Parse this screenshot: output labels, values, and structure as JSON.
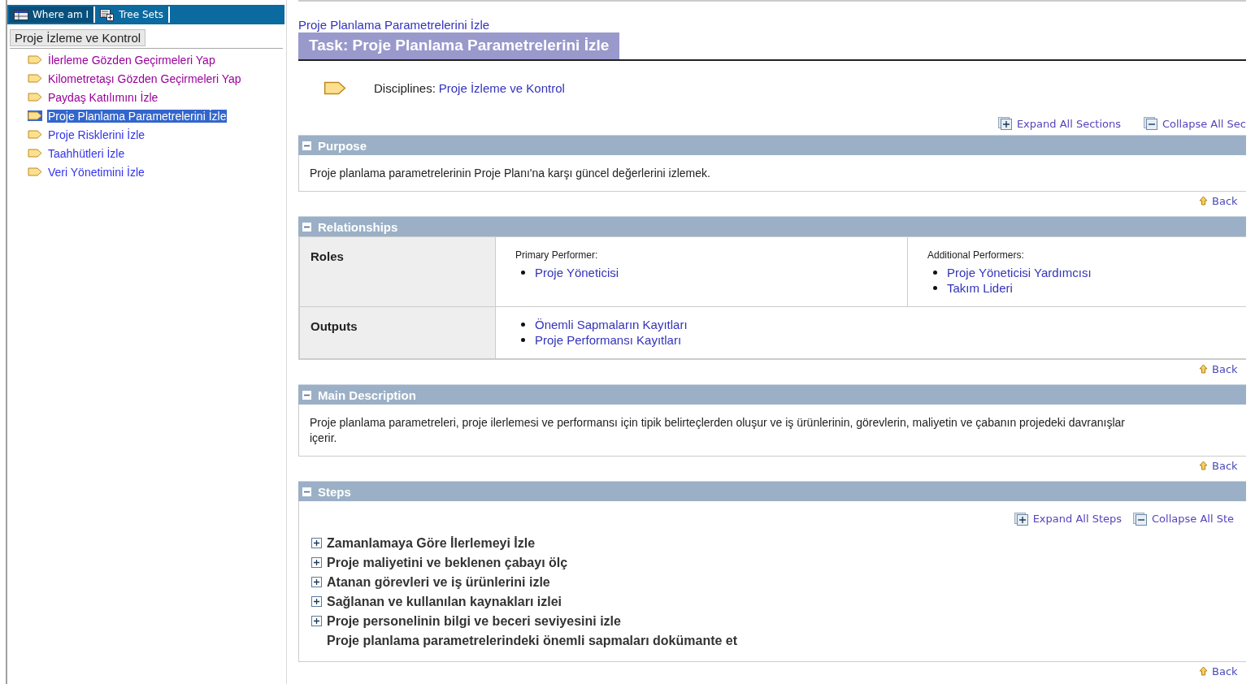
{
  "sidebar": {
    "tabs": [
      {
        "label": "Where am I",
        "selected": true
      },
      {
        "label": "Tree Sets",
        "selected": false
      }
    ],
    "root": "Proje İzleme ve Kontrol",
    "items": [
      {
        "label": "İlerleme Gözden Geçirmeleri Yap",
        "visited": true,
        "selected": false
      },
      {
        "label": "Kilometretaşı Gözden Geçirmeleri Yap",
        "visited": true,
        "selected": false
      },
      {
        "label": "Paydaş Katılımını İzle",
        "visited": true,
        "selected": false
      },
      {
        "label": "Proje Planlama Parametrelerini İzle",
        "visited": false,
        "selected": true
      },
      {
        "label": "Proje Risklerini İzle",
        "visited": false,
        "selected": false
      },
      {
        "label": "Taahhütleri İzle",
        "visited": false,
        "selected": false
      },
      {
        "label": "Veri Yönetimini İzle",
        "visited": false,
        "selected": false
      }
    ]
  },
  "breadcrumb": "Proje Planlama Parametrelerini İzle",
  "title": "Task: Proje Planlama Parametrelerini İzle",
  "disciplines": {
    "label": "Disciplines:",
    "link": "Proje İzleme ve Kontrol"
  },
  "section_controls": [
    "Expand All Sections",
    "Collapse All Sec"
  ],
  "purpose": {
    "title": "Purpose",
    "text": "Proje planlama parametrelerinin Proje Planı'na karşı güncel değerlerini izlemek.",
    "back": "Back"
  },
  "relationships": {
    "title": "Relationships",
    "roles_label": "Roles",
    "primary_label": "Primary Performer:",
    "primary": [
      "Proje Yöneticisi"
    ],
    "additional_label": "Additional Performers:",
    "additional": [
      "Proje Yöneticisi Yardımcısı",
      "Takım Lideri"
    ],
    "outputs_label": "Outputs",
    "outputs": [
      "Önemli Sapmaların Kayıtları",
      "Proje Performansı Kayıtları"
    ],
    "back": "Back"
  },
  "main_description": {
    "title": "Main Description",
    "text": "Proje planlama parametreleri, proje ilerlemesi ve performansı için tipik belirteçlerden oluşur ve iş ürünlerinin, görevlerin, maliyetin ve çabanın projedeki davranışlar",
    "text_line2": "içerir.",
    "back": "Back"
  },
  "steps": {
    "title": "Steps",
    "controls": [
      "Expand All Steps",
      "Collapse All Ste"
    ],
    "items": [
      {
        "label": "Zamanlamaya Göre İlerlemeyi İzle",
        "expandable": true
      },
      {
        "label": "Proje maliyetini ve beklenen çabayı ölç",
        "expandable": true
      },
      {
        "label": "Atanan görevleri ve iş ürünlerini izle",
        "expandable": true
      },
      {
        "label": "Sağlanan ve kullanılan kaynakları izlei",
        "expandable": true
      },
      {
        "label": "Proje personelinin bilgi ve beceri seviyesini izle",
        "expandable": true
      },
      {
        "label": "Proje planlama parametrelerindeki önemli sapmaları dokümante et",
        "expandable": false
      }
    ],
    "back": "Back"
  }
}
